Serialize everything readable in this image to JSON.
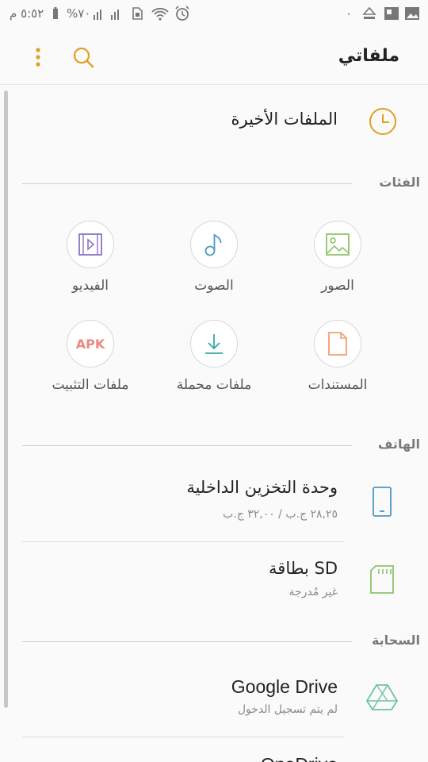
{
  "status_bar": {
    "time": "٥:٥٢ م",
    "battery": "%٧٠",
    "notification_count": "٠"
  },
  "header": {
    "title": "ملفاتي"
  },
  "recent": {
    "label": "الملفات الأخيرة"
  },
  "categories": {
    "label": "الفئات",
    "items": [
      {
        "label": "الصور",
        "icon": "image-icon",
        "color": "#8cc56a"
      },
      {
        "label": "الصوت",
        "icon": "music-note-icon",
        "color": "#4c97c8"
      },
      {
        "label": "الفيديو",
        "icon": "video-icon",
        "color": "#8a72c8"
      },
      {
        "label": "المستندات",
        "icon": "document-icon",
        "color": "#f0a070"
      },
      {
        "label": "ملفات محملة",
        "icon": "download-icon",
        "color": "#3aa7a0"
      },
      {
        "label": "ملفات التثبيت",
        "icon": "apk-icon",
        "icon_text": "APK",
        "color": "#e88a80"
      }
    ]
  },
  "phone": {
    "label": "الهاتف",
    "items": [
      {
        "title": "وحدة التخزين الداخلية",
        "subtitle": "٢٨,٢٥ ج.ب / ٣٢,٠٠ ج.ب",
        "icon": "phone-icon",
        "color": "#4c97c8"
      },
      {
        "title": "بطاقة SD",
        "subtitle": "غير مُدرجة",
        "icon": "sd-card-icon",
        "color": "#8cc56a"
      }
    ]
  },
  "cloud": {
    "label": "السحابة",
    "items": [
      {
        "title": "Google Drive",
        "subtitle": "لم يتم تسجيل الدخول",
        "icon": "google-drive-icon",
        "color": "#6fc1a8"
      },
      {
        "title": "OneDrive",
        "subtitle": "",
        "icon": "onedrive-icon"
      }
    ]
  },
  "colors": {
    "accent": "#e0a020"
  }
}
